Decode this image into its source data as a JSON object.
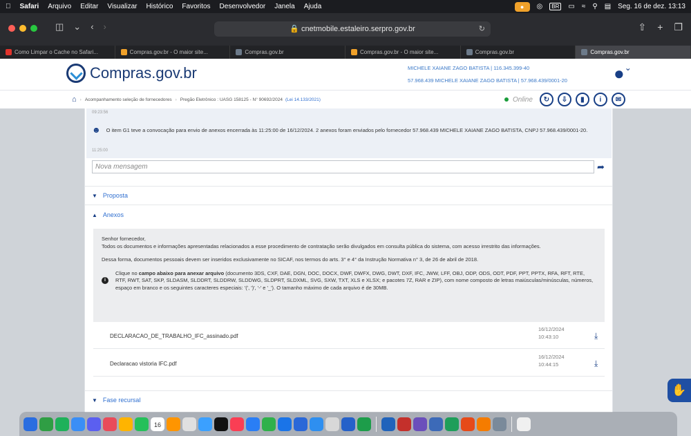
{
  "menubar": {
    "app": "Safari",
    "items": [
      "Arquivo",
      "Editar",
      "Visualizar",
      "Histórico",
      "Favoritos",
      "Desenvolvedor",
      "Janela",
      "Ajuda"
    ],
    "input_source": "BR",
    "datetime": "Seg. 16 de dez.  13:13"
  },
  "browser": {
    "url": "cnetmobile.estaleiro.serpro.gov.br"
  },
  "tabs": [
    {
      "label": "Como Limpar o Cache no Safari...",
      "color": "#e0332c"
    },
    {
      "label": "Compras.gov.br - O maior site...",
      "color": "#f0a12a"
    },
    {
      "label": "Compras.gov.br",
      "color": "#6c7a8a"
    },
    {
      "label": "Compras.gov.br - O maior site...",
      "color": "#f0a12a"
    },
    {
      "label": "Compras.gov.br",
      "color": "#6c7a8a"
    },
    {
      "label": "Compras.gov.br",
      "color": "#6c7a8a",
      "active": true
    }
  ],
  "site": {
    "logo_text": "Compras.gov.br",
    "user_line1": "MICHELE XAIANE ZAGO BATISTA | 116.345.399-40",
    "user_line2": "57.968.439 MICHELE XAIANE ZAGO BATISTA | 57.968.439/0001-20"
  },
  "breadcrumb": {
    "item1": "Acompanhamento seleção de fornecedores",
    "item2": "Pregão Eletrônico : UASG 158125 - N° 90692/2024",
    "law": "(Lei 14.133/2021)",
    "status": "Online"
  },
  "chat": {
    "timestamp_top": "09:23:56",
    "message": "O item G1 teve a convocação para envio de anexos encerrada às 11:25:00 de 16/12/2024. 2 anexos foram enviados pelo fornecedor 57.968.439 MICHELE XAIANE ZAGO BATISTA, CNPJ 57.968.439/0001-20.",
    "timestamp_msg": "11:25:00",
    "input_placeholder": "Nova mensagem"
  },
  "sections": {
    "proposta": "Proposta",
    "anexos": "Anexos",
    "fase_recursal": "Fase recursal"
  },
  "notice": {
    "greeting": "Senhor fornecedor,",
    "p1": "Todos os documentos e informações apresentadas relacionados a esse procedimento de contratação serão divulgados em consulta pública do sistema, com acesso irrestrito das informações.",
    "p2": "Dessa forma, documentos pessoais devem ser inseridos exclusivamente no SICAF, nos termos do arts. 3° e 4° da Instrução Normativa n° 3, de 26 de abril de 2018.",
    "inst_prefix": "Clique no",
    "inst_bold": "campo abaixo para anexar arquivo",
    "inst_rest": "(documento 3DS, CXF, DAE, DGN, DOC, DOCX, DWF, DWFX, DWG, DWT, DXF, IFC, JWW, LFF, OBJ, ODP, ODS, ODT, PDF, PPT, PPTX, RFA, RFT, RTE, RTF, RWT, SAT, SKP, SLDASM, SLDDRT, SLDDRW, SLDDWG, SLDPRT, SLDXML, SVG, SXW, TXT, XLS e XLSX; e pacotes 7Z, RAR e ZIP), com nome composto de letras maiúsculas/minúsculas, números, espaço em branco e os seguintes caracteres especiais: '(', ')', '-' e '_'). O tamanho máximo de cada arquivo é de 30MB."
  },
  "files": [
    {
      "name": "DECLARACAO_DE_TRABALHO_IFC_assinado.pdf",
      "date": "16/12/2024",
      "time": "10:43:10"
    },
    {
      "name": "Declaracao vistoria IFC.pdf",
      "date": "16/12/2024",
      "time": "10:44:15"
    }
  ],
  "dock": {
    "calendar_day": "16",
    "colors": [
      "#2a6de0",
      "#2f9e44",
      "#1fb15a",
      "#3a8ef6",
      "#5b5ff0",
      "#e94b5a",
      "#ffb400",
      "#25c05a",
      "#ffffff",
      "#ff9500",
      "#e0e0e0",
      "#3ba0ff",
      "#111111",
      "#fa3e54",
      "#2a7ef5",
      "#2fb14a",
      "#1a74e8",
      "#2a68d8",
      "#2e8ff0",
      "#d8d8d8",
      "#2561c9",
      "#1d9d4a",
      "#2063bb",
      "#c4302b",
      "#6b4fbb",
      "#3c6ab8",
      "#1e9e5a",
      "#e64a19",
      "#f57c00",
      "#7a8a9a",
      "#f0f0f0"
    ]
  }
}
